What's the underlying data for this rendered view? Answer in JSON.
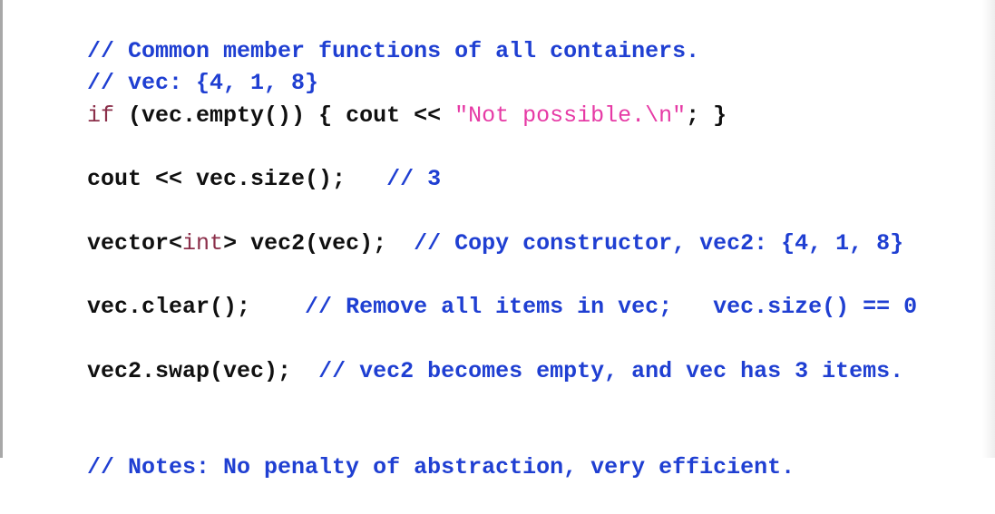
{
  "editor": {
    "colors": {
      "comment": "#1f3fd2",
      "code": "#101010",
      "keyword": "#8b2f4a",
      "string": "#e63aa5",
      "background": "#ffffff"
    },
    "lines": [
      {
        "comment": "// Common member functions of all containers."
      },
      {
        "comment": "// vec: {4, 1, 8}"
      },
      {
        "keyword": "if",
        "code_before": " (vec.empty()) { cout << ",
        "string": "\"Not possible.\\n\"",
        "code_after": "; }"
      },
      {
        "code": "cout << vec.size();",
        "comment": "   // 3"
      },
      {
        "code_before": "vector<",
        "type": "int",
        "code_after": "> vec2(vec);",
        "comment": "  // Copy constructor, vec2: {4, 1, 8}"
      },
      {
        "code": "vec.clear();",
        "comment": "    // Remove all items in vec;   vec.size() == 0"
      },
      {
        "code": "vec2.swap(vec);",
        "comment": "  // vec2 becomes empty, and vec has 3 items."
      },
      {
        "comment": "// Notes: No penalty of abstraction, very efficient."
      }
    ]
  }
}
